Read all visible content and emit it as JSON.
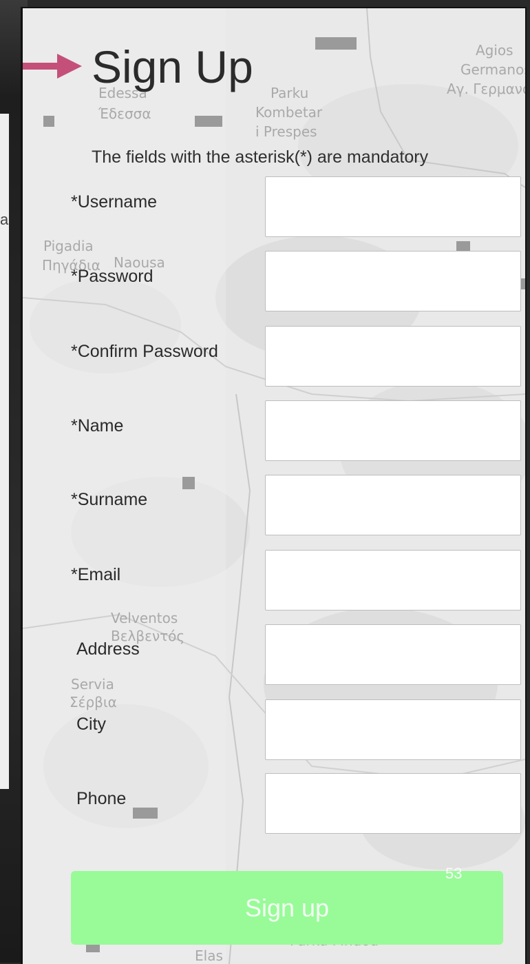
{
  "form": {
    "title": "Sign Up",
    "mandatory_note": "The fields with the asterisk(*) are mandatory",
    "fields": [
      {
        "label": "*Username",
        "value": ""
      },
      {
        "label": "*Password",
        "value": ""
      },
      {
        "label": "*Confirm Password",
        "value": ""
      },
      {
        "label": "*Name",
        "value": ""
      },
      {
        "label": "*Surname",
        "value": ""
      },
      {
        "label": "*Email",
        "value": ""
      },
      {
        "label": "Address",
        "value": ""
      },
      {
        "label": "City",
        "value": ""
      },
      {
        "label": "Phone",
        "value": ""
      }
    ],
    "submit_label": "Sign up"
  },
  "slide": {
    "number": "53",
    "left_slide_fragment": "a"
  },
  "map_labels": [
    "Edessa",
    "Έδεσσα",
    "Parku",
    "Kombetar",
    "i Prespes",
    "Agios",
    "Germanos",
    "Αγ. Γερμανός",
    "Pigadia",
    "Πηγάδια",
    "Naousa",
    "Velventos",
    "Βελβεντός",
    "Servia",
    "Σέρβια",
    "Parku Pindou",
    "Elas"
  ],
  "colors": {
    "accent_arrow": "#c45079",
    "submit_bg": "#98fb98",
    "submit_text": "#f4fff4",
    "panel_bg": "#ececec"
  }
}
